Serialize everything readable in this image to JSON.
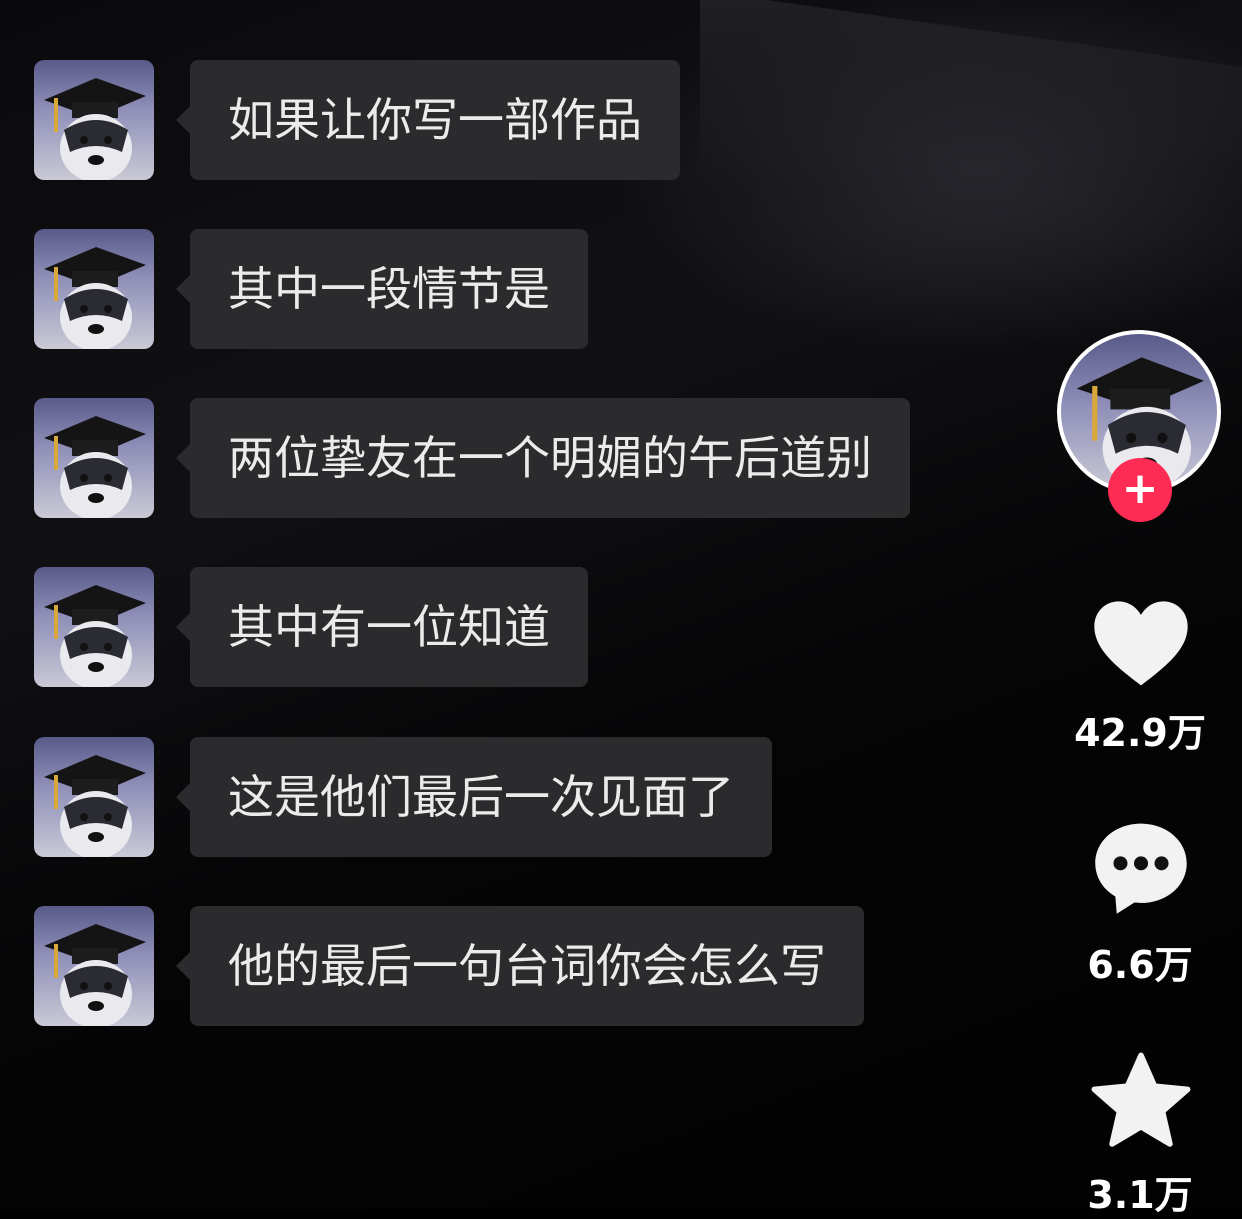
{
  "messages": [
    {
      "text": "如果让你写一部作品"
    },
    {
      "text": "其中一段情节是"
    },
    {
      "text": "两位挚友在一个明媚的午后道别"
    },
    {
      "text": "其中有一位知道"
    },
    {
      "text": "这是他们最后一次见面了"
    },
    {
      "text": "他的最后一句台词你会怎么写"
    }
  ],
  "sidebar": {
    "follow_label": "+",
    "likes_count": "42.9万",
    "comments_count": "6.6万",
    "favorites_count": "3.1万"
  },
  "colors": {
    "bubble": "#2b2b2d",
    "follow": "#fe2c55",
    "icon": "#f2f2f2"
  },
  "icons": {
    "avatar": "husky-graduation-cap-avatar",
    "like": "heart-icon",
    "comment": "comment-bubble-icon",
    "favorite": "star-icon"
  }
}
